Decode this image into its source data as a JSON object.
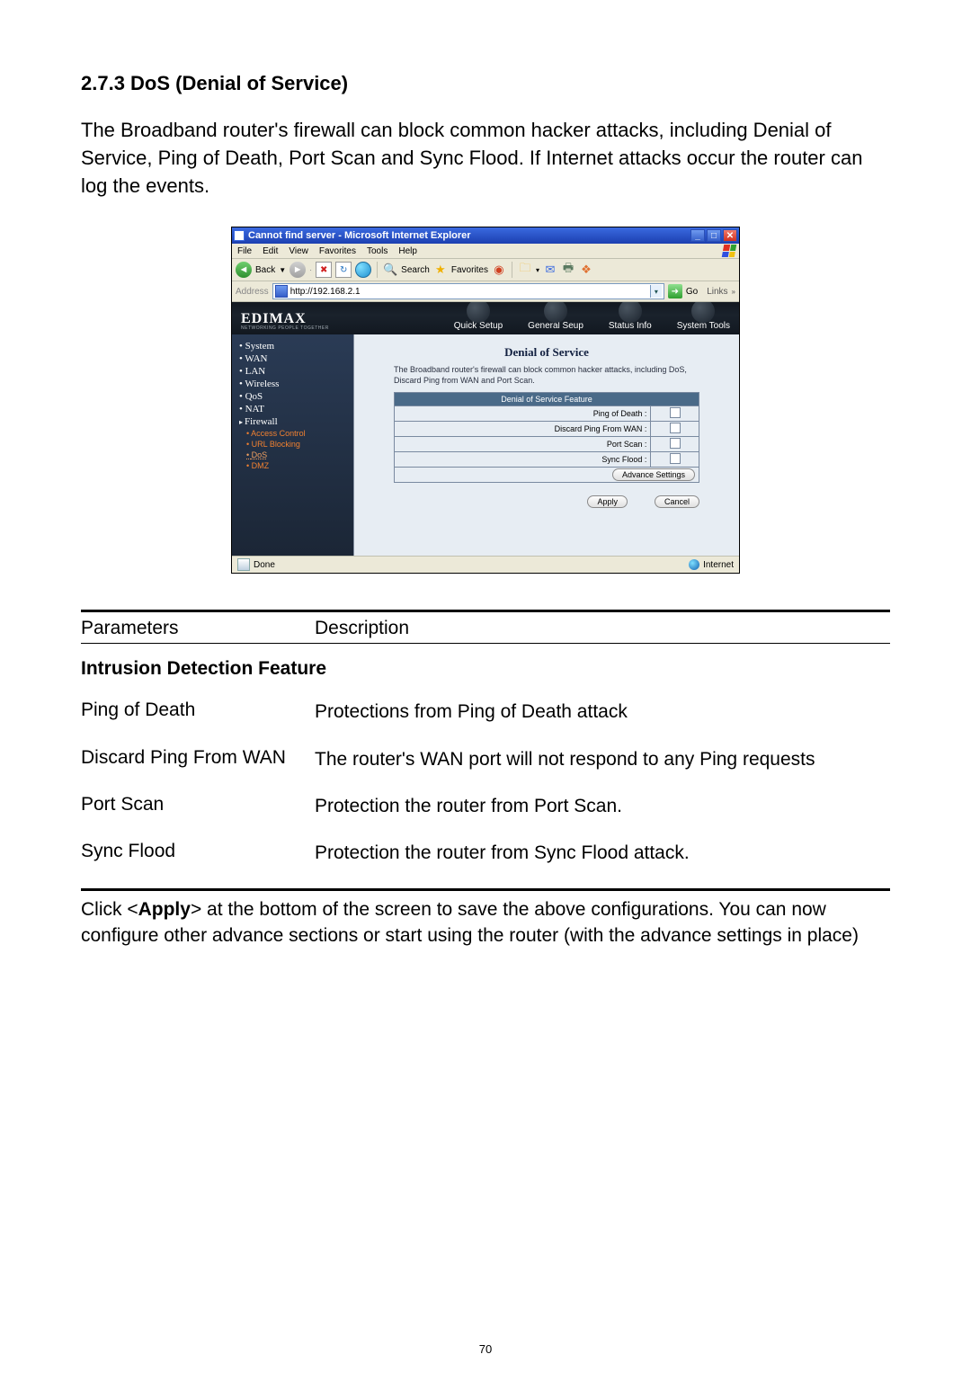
{
  "doc": {
    "section_no": "2.7.3 DoS (Denial of Service)",
    "intro": "The Broadband router's firewall can block common hacker attacks, including Denial of Service, Ping of Death, Port Scan and Sync Flood. If Internet attacks occur the router can log the events.",
    "param_header": {
      "c1": "Parameters",
      "c2": "Description"
    },
    "feature_title": "Intrusion Detection Feature",
    "rows": [
      {
        "p": "Ping of Death",
        "d": "Protections from Ping of Death attack"
      },
      {
        "p": "Discard Ping From WAN",
        "d": "The router's WAN port will not respond to any Ping requests"
      },
      {
        "p": "Port Scan",
        "d": "Protection the router from Port Scan."
      },
      {
        "p": "Sync Flood",
        "d": "Protection the router from Sync Flood attack."
      }
    ],
    "closing_pre": "Click <",
    "closing_apply": "Apply",
    "closing_post": "> at the bottom of the screen to save the above configurations. You can now configure other advance sections or start using the router (with the advance settings in place)",
    "page_number": "70"
  },
  "ie": {
    "title": "Cannot find server - Microsoft Internet Explorer",
    "menus": [
      "File",
      "Edit",
      "View",
      "Favorites",
      "Tools",
      "Help"
    ],
    "toolbar": {
      "back": "Back",
      "search": "Search",
      "favorites": "Favorites"
    },
    "address_label": "Address",
    "url": "http://192.168.2.1",
    "go": "Go",
    "links": "Links",
    "status_left": "Done",
    "status_right": "Internet"
  },
  "page": {
    "brand": "EDIMAX",
    "brand_slogan": "NETWORKING PEOPLE TOGETHER",
    "tabs": [
      "Quick Setup",
      "General Seup",
      "Status Info",
      "System Tools"
    ],
    "side": [
      {
        "label": "System",
        "type": "bullet"
      },
      {
        "label": "WAN",
        "type": "bullet"
      },
      {
        "label": "LAN",
        "type": "bullet"
      },
      {
        "label": "Wireless",
        "type": "bullet"
      },
      {
        "label": "QoS",
        "type": "bullet"
      },
      {
        "label": "NAT",
        "type": "bullet"
      },
      {
        "label": "Firewall",
        "type": "current"
      }
    ],
    "subs": [
      {
        "label": "Access Control",
        "active": false
      },
      {
        "label": "URL Blocking",
        "active": false
      },
      {
        "label": "DoS",
        "active": true
      },
      {
        "label": "DMZ",
        "active": false
      }
    ],
    "dos_title": "Denial of Service",
    "dos_desc": "The Broadband router's firewall can block common hacker attacks, including DoS, Discard Ping from WAN and Port Scan.",
    "feature_header": "Denial of Service Feature",
    "features": [
      "Ping of Death :",
      "Discard Ping From WAN :",
      "Port Scan :",
      "Sync Flood :"
    ],
    "advance": "Advance Settings",
    "apply": "Apply",
    "cancel": "Cancel"
  }
}
